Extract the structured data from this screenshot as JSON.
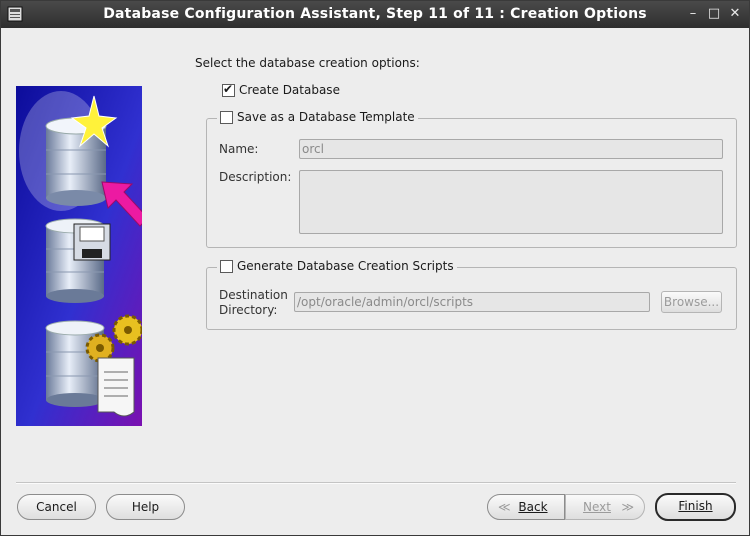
{
  "window": {
    "title": "Database Configuration Assistant, Step 11 of 11 : Creation Options",
    "minimize_glyph": "–",
    "maximize_glyph": "□",
    "close_glyph": "✕"
  },
  "main": {
    "heading": "Select the database creation options:",
    "create_database": {
      "label": "Create Database",
      "checked": true,
      "check_glyph": "✔"
    },
    "save_template": {
      "label": "Save as a Database Template",
      "checked": false,
      "name_label": "Name:",
      "name_value": "orcl",
      "description_label": "Description:",
      "description_value": ""
    },
    "generate_scripts": {
      "label": "Generate Database Creation Scripts",
      "checked": false,
      "destination_label_line1": "Destination",
      "destination_label_line2": "Directory:",
      "destination_value": "/opt/oracle/admin/orcl/scripts",
      "browse_label": "Browse..."
    }
  },
  "footer": {
    "cancel_label": "Cancel",
    "help_label": "Help",
    "back_label": "Back",
    "next_label": "Next",
    "finish_label": "Finish",
    "back_chevron": "≪",
    "next_chevron": "≫"
  },
  "colors": {
    "titlebar": "#333333",
    "banner_blue": "#1a1aa0",
    "arrow_magenta": "#e0109a",
    "star_yellow": "#ffef30"
  }
}
